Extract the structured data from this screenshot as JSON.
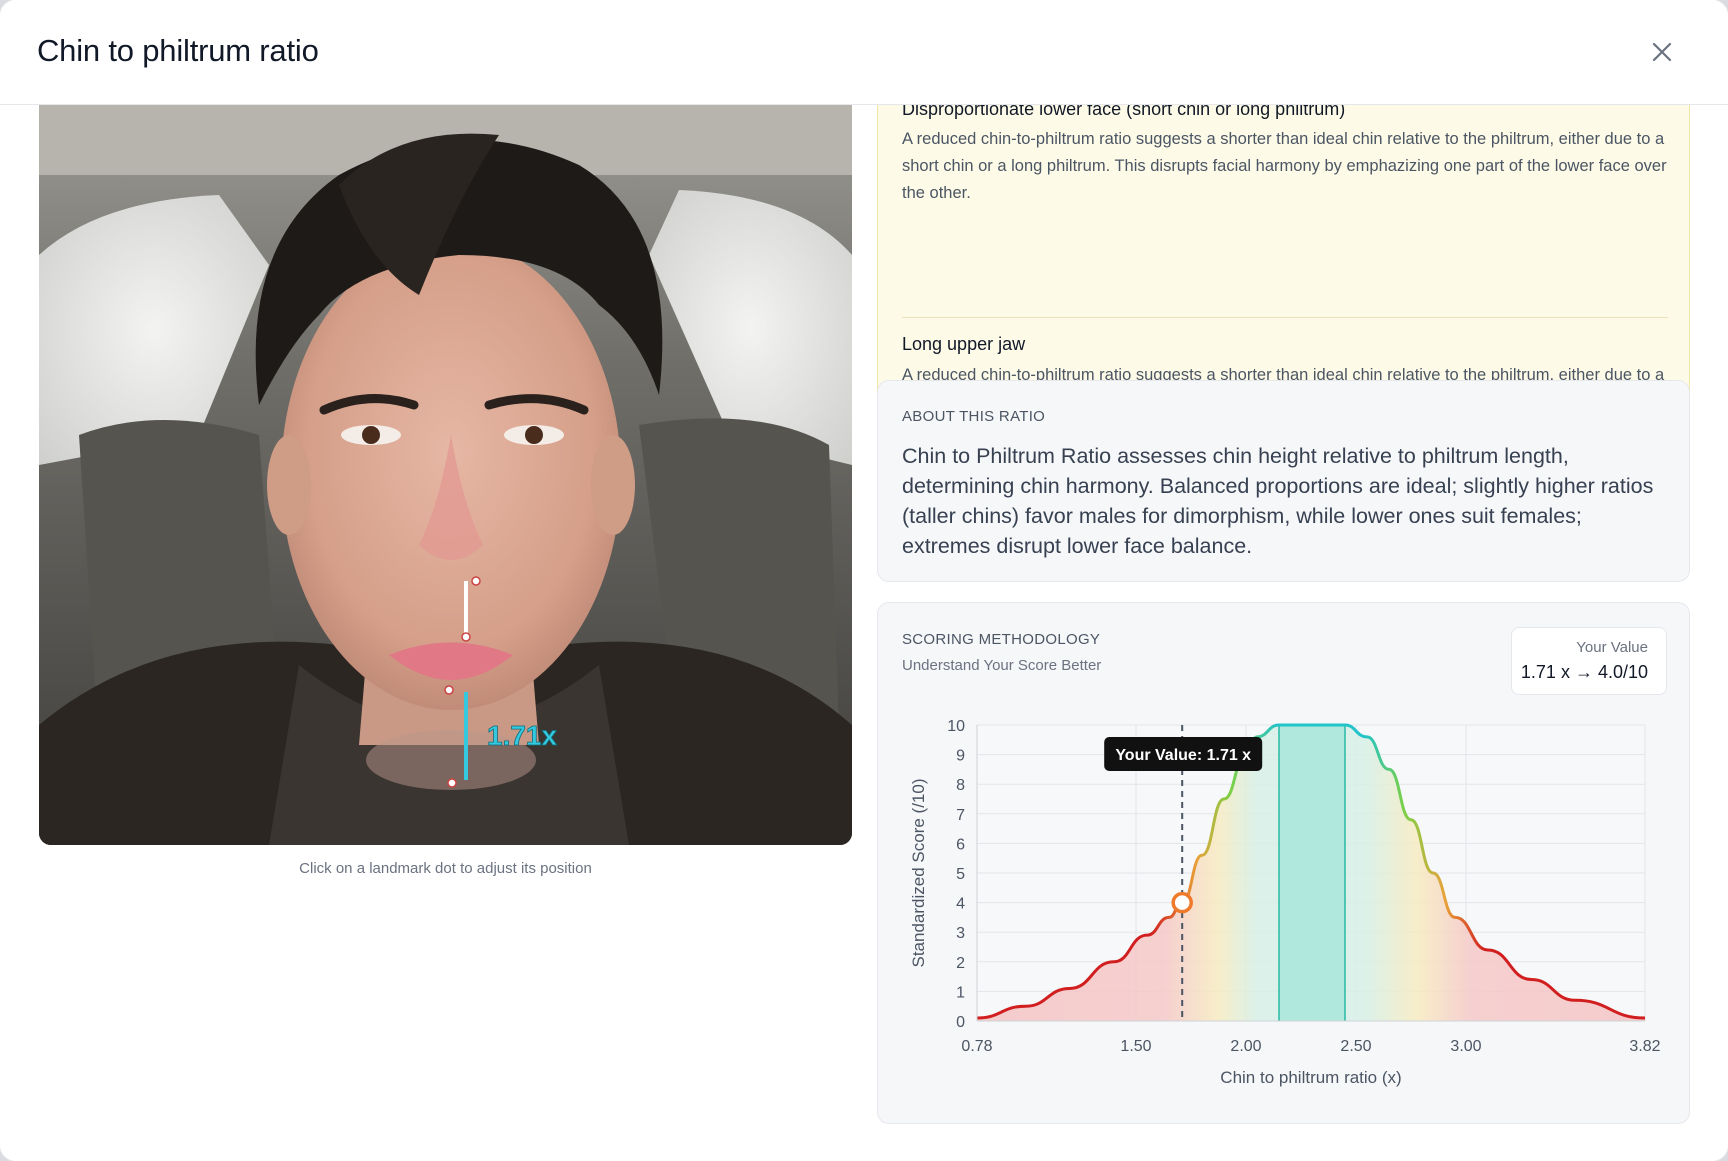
{
  "modal": {
    "title": "Chin to philtrum ratio",
    "close_label": "×"
  },
  "photo": {
    "measurement_label": "1.71x",
    "caption": "Click on a landmark dot to adjust its position",
    "measurement_color": "#35c9e0"
  },
  "warnings": [
    {
      "title": "Disproportionate lower face (short chin or long philtrum)",
      "description": "A reduced chin-to-philtrum ratio suggests a shorter than ideal chin relative to the philtrum, either due to a short chin or a long philtrum. This disrupts facial harmony by emphazizing one part of the lower face over the other."
    },
    {
      "title": "Long upper jaw",
      "description": "A reduced chin-to-philtrum ratio suggests a shorter than ideal chin relative to the philtrum, either due to a short chin or a long philtrum. This disrupts facial harmony by overemphasizing the upper jaw relative to the lower jaw."
    }
  ],
  "about": {
    "kicker": "ABOUT THIS RATIO",
    "text": "Chin to Philtrum Ratio assesses chin height relative to philtrum length, determining chin harmony. Balanced proportions are ideal; slightly higher ratios (taller chins) favor males for dimorphism, while lower ones suit females; extremes disrupt lower face balance."
  },
  "scoring": {
    "kicker": "SCORING METHODOLOGY",
    "subtitle": "Understand Your Score Better",
    "your_value_label": "Your Value",
    "your_value": "1.71 x → 4.0/10"
  },
  "chart_data": {
    "type": "area",
    "xlabel": "Chin to philtrum ratio (x)",
    "ylabel": "Standardized Score (/10)",
    "x_ticks": [
      "0.78",
      "1.50",
      "2.00",
      "2.50",
      "3.00",
      "3.82"
    ],
    "y_ticks": [
      "0",
      "1",
      "2",
      "3",
      "4",
      "5",
      "6",
      "7",
      "8",
      "9",
      "10"
    ],
    "xlim": [
      0.78,
      3.82
    ],
    "ylim": [
      0,
      10
    ],
    "grid": true,
    "x": [
      0.78,
      1.0,
      1.2,
      1.4,
      1.55,
      1.65,
      1.71,
      1.8,
      1.9,
      2.0,
      2.05,
      2.15,
      2.45,
      2.55,
      2.65,
      2.75,
      2.85,
      2.95,
      3.1,
      3.3,
      3.5,
      3.82
    ],
    "y": [
      0.1,
      0.5,
      1.1,
      2.0,
      2.9,
      3.5,
      4.0,
      5.6,
      7.5,
      9.0,
      9.6,
      10,
      10,
      9.6,
      8.5,
      6.8,
      5.0,
      3.5,
      2.4,
      1.4,
      0.7,
      0.1
    ],
    "ideal_range": [
      2.15,
      2.45
    ],
    "user_value": 1.71,
    "user_score": 4.0,
    "tooltip": "Your Value: 1.71 x",
    "colors": {
      "low": "#d11f1f",
      "mid": "#e8a33a",
      "good": "#7bd047",
      "ideal": "#22c3c9",
      "ideal_fill": "#a9e6dc",
      "marker": "#f07a2c"
    }
  }
}
